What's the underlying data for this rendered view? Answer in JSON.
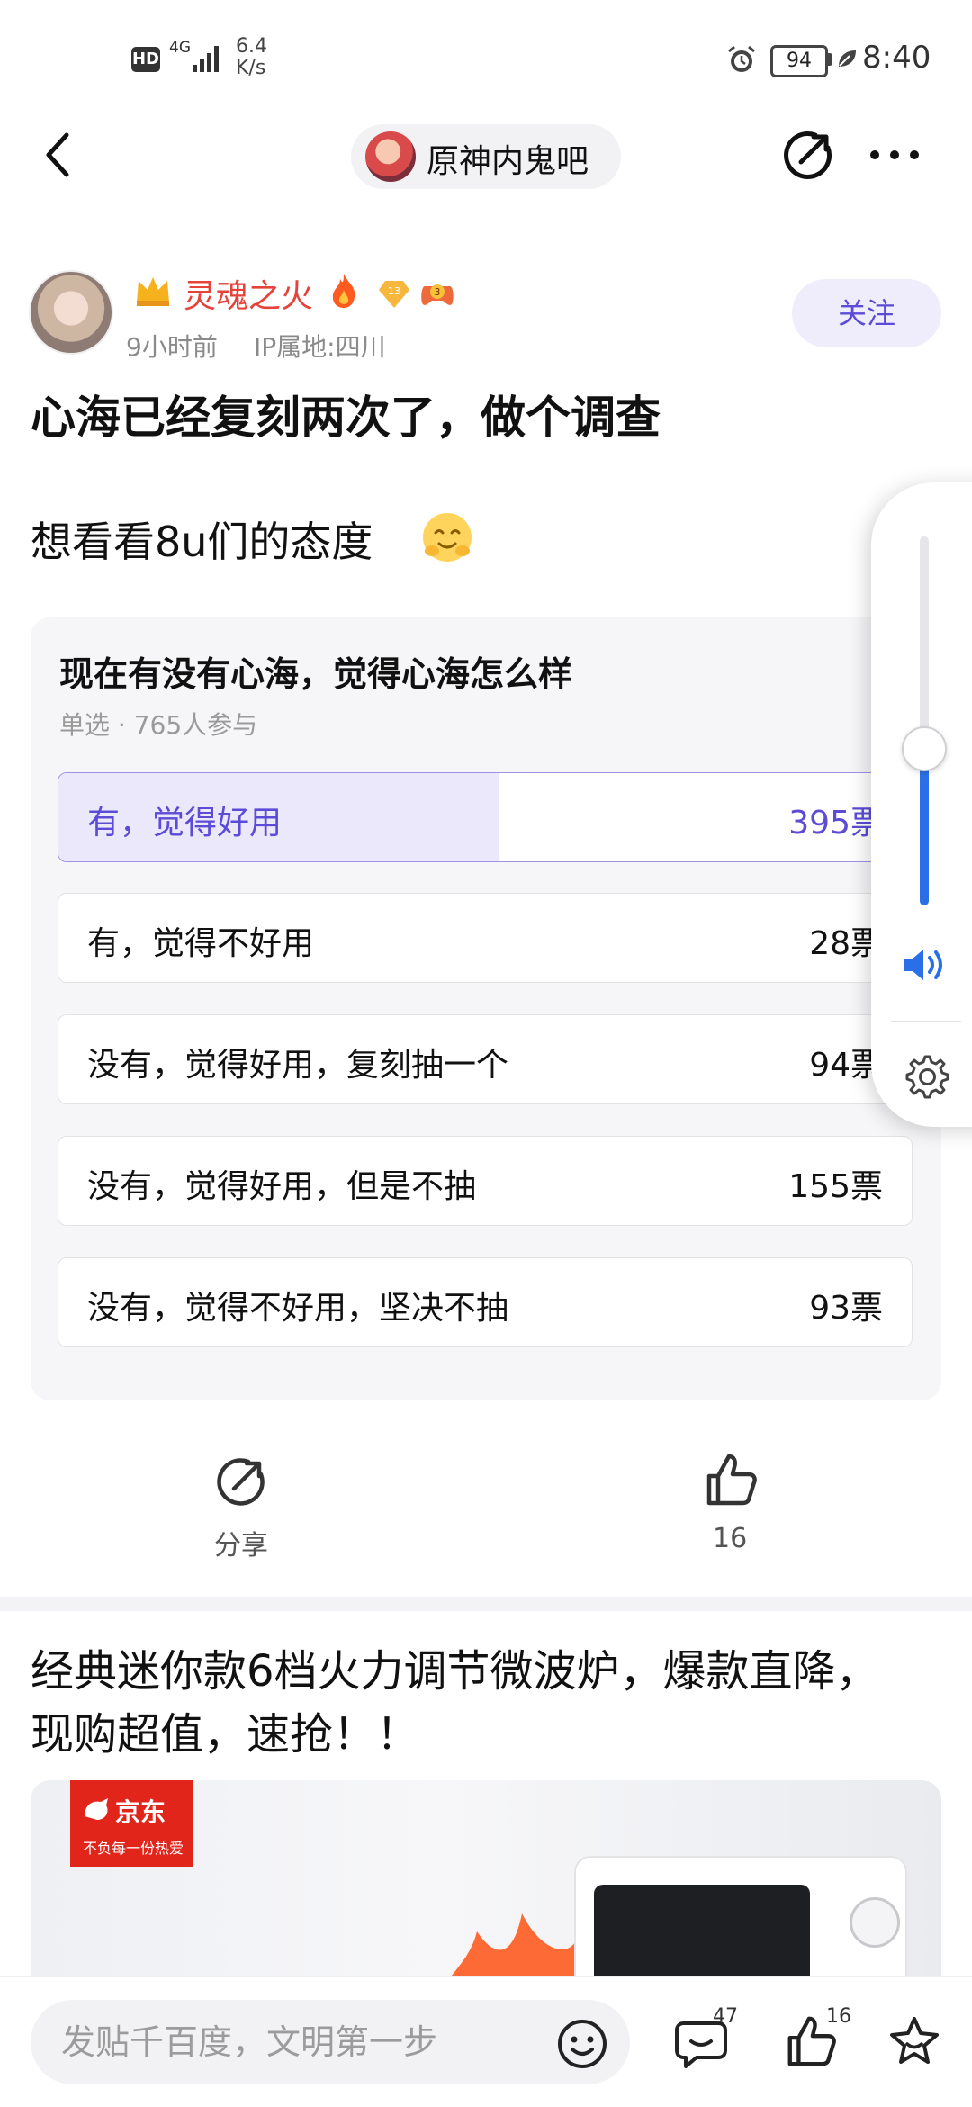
{
  "status_bar": {
    "hd": "HD",
    "network": "4G",
    "speed_value": "6.4",
    "speed_unit": "K/s",
    "battery": "94",
    "time": "8:40"
  },
  "nav": {
    "forum_name": "原神内鬼吧"
  },
  "post": {
    "author": "灵魂之火",
    "badge_level_1": "13",
    "badge_level_2": "3",
    "time_ago": "9小时前",
    "ip": "IP属地:四川",
    "follow_label": "关注",
    "title": "心海已经复刻两次了，做个调查",
    "body": "想看看8u们的态度"
  },
  "poll": {
    "question": "现在有没有心海，觉得心海怎么样",
    "meta": "单选 · 765人参与",
    "options": [
      {
        "label": "有，觉得好用",
        "count": "395票",
        "selected": true,
        "fraction": 0.516
      },
      {
        "label": "有，觉得不好用",
        "count": "28票",
        "selected": false,
        "fraction": 0.037
      },
      {
        "label": "没有，觉得好用，复刻抽一个",
        "count": "94票",
        "selected": false,
        "fraction": 0.123
      },
      {
        "label": "没有，觉得好用，但是不抽",
        "count": "155票",
        "selected": false,
        "fraction": 0.203
      },
      {
        "label": "没有，觉得不好用，坚决不抽",
        "count": "93票",
        "selected": false,
        "fraction": 0.122
      }
    ]
  },
  "volume": {
    "level": 0.43
  },
  "actions": {
    "share_label": "分享",
    "like_count": "16"
  },
  "ad": {
    "title": "经典迷你款6档火力调节微波炉，爆款直降，现购超值，速抢！！",
    "brand": "京东",
    "brand_slogan": "不负每一份热爱"
  },
  "bottom_bar": {
    "reply_placeholder": "发贴千百度，文明第一步",
    "comment_count": "47",
    "like_count": "16"
  },
  "colors": {
    "accent": "#5b4bd6",
    "author_name": "#e5423a",
    "volume_fill": "#2b6fe8",
    "jd_red": "#e1251b"
  }
}
